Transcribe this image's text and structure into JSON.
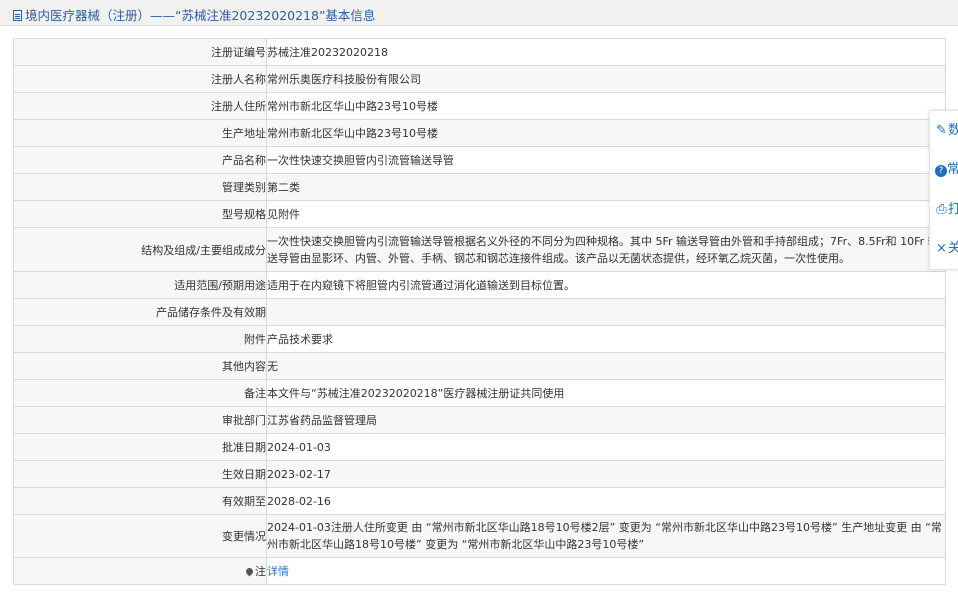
{
  "header": {
    "title": "境内医疗器械（注册）——“苏械注准20232020218”基本信息"
  },
  "rows": [
    {
      "label": "注册证编号",
      "value": "苏械注准20232020218"
    },
    {
      "label": "注册人名称",
      "value": "常州乐奥医疗科技股份有限公司"
    },
    {
      "label": "注册人住所",
      "value": "常州市新北区华山中路23号10号楼"
    },
    {
      "label": "生产地址",
      "value": "常州市新北区华山中路23号10号楼"
    },
    {
      "label": "产品名称",
      "value": "一次性快速交换胆管内引流管输送导管"
    },
    {
      "label": "管理类别",
      "value": "第二类"
    },
    {
      "label": "型号规格",
      "value": "见附件"
    },
    {
      "label": "结构及组成/主要组成成分",
      "value": "一次性快速交换胆管内引流管输送导管根据名义外径的不同分为四种规格。其中 5Fr 输送导管由外管和手持部组成；7Fr、8.5Fr和 10Fr 输送导管由显影环、内管、外管、手柄、钢芯和钢芯连接件组成。该产品以无菌状态提供，经环氧乙烷灭菌，一次性使用。"
    },
    {
      "label": "适用范围/预期用途",
      "value": "适用于在内窥镜下将胆管内引流管通过消化道输送到目标位置。"
    },
    {
      "label": "产品储存条件及有效期",
      "value": ""
    },
    {
      "label": "附件",
      "value": "产品技术要求"
    },
    {
      "label": "其他内容",
      "value": "无"
    },
    {
      "label": "备注",
      "value": "本文件与“苏械注准20232020218”医疗器械注册证共同使用"
    },
    {
      "label": "审批部门",
      "value": "江苏省药品监督管理局"
    },
    {
      "label": "批准日期",
      "value": "2024-01-03"
    },
    {
      "label": "生效日期",
      "value": "2023-02-17"
    },
    {
      "label": "有效期至",
      "value": "2028-02-16"
    },
    {
      "label": "变更情况",
      "value": "2024-01-03注册人住所变更 由 “常州市新北区华山路18号10号楼2层” 变更为 “常州市新北区华山中路23号10号楼” 生产地址变更 由 “常州市新北区华山路18号10号楼” 变更为 “常州市新北区华山中路23号10号楼”"
    }
  ],
  "note_row": {
    "label": "注",
    "link": "详情"
  },
  "side_panel": {
    "items": [
      {
        "icon": "edit-icon",
        "label": "数"
      },
      {
        "icon": "help-icon",
        "label": "常"
      },
      {
        "icon": "print-icon",
        "label": "打"
      },
      {
        "icon": "close-icon",
        "label": "关"
      }
    ]
  },
  "colors": {
    "link": "#2a78c8",
    "title": "#2b5f9e",
    "label_bg": "#f7f7f7",
    "border": "#d9d9d9"
  }
}
